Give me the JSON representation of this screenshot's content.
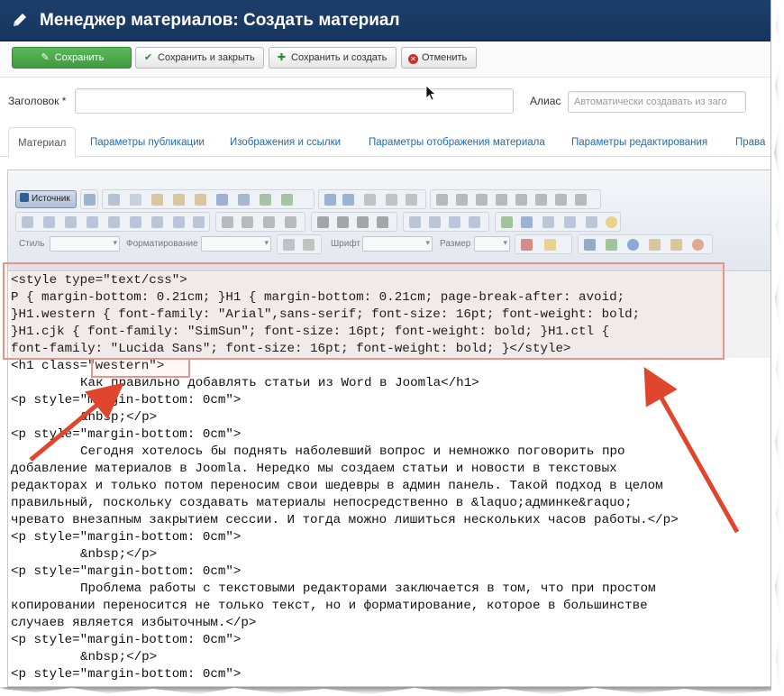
{
  "header": {
    "title": "Менеджер материалов: Создать материал"
  },
  "toolbar": {
    "save": "Сохранить",
    "save_close": "Сохранить и закрыть",
    "save_new": "Сохранить и создать",
    "cancel": "Отменить"
  },
  "form": {
    "title_label": "Заголовок *",
    "title_value": "",
    "alias_label": "Алиас",
    "alias_placeholder": "Автоматически создавать из заго"
  },
  "tabs": [
    {
      "label": "Материал",
      "active": true
    },
    {
      "label": "Параметры публикации"
    },
    {
      "label": "Изображения и ссылки"
    },
    {
      "label": "Параметры отображения материала"
    },
    {
      "label": "Параметры редактирования"
    },
    {
      "label": "Права"
    }
  ],
  "editor": {
    "source_button": "Источник",
    "combos": {
      "style_label": "Стиль",
      "format_label": "Форматирование",
      "font_label": "Шрифт",
      "size_label": "Размер"
    },
    "code_lines": [
      "<style type=\"text/css\">",
      "P { margin-bottom: 0.21cm; }H1 { margin-bottom: 0.21cm; page-break-after: avoid;",
      "}H1.western { font-family: \"Arial\",sans-serif; font-size: 16pt; font-weight: bold;",
      "}H1.cjk { font-family: \"SimSun\"; font-size: 16pt; font-weight: bold; }H1.ctl {",
      "font-family: \"Lucida Sans\"; font-size: 16pt; font-weight: bold; }</style>",
      "<h1 class=\"western\">",
      "Как правильно добавлять статьи из Word в Joomla</h1>",
      "<p style=\"margin-bottom: 0cm\">",
      "&nbsp;</p>",
      "<p style=\"margin-bottom: 0cm\">",
      "Сегодня хотелось бы поднять наболевший вопрос и немножко поговорить про",
      "добавление материалов в Joomla. Нередко мы создаем статьи и новости в текстовых",
      "редакторах и только потом переносим свои шедевры в админ панель. Такой подход в целом",
      "правильный, поскольку создавать материалы непосредственно в &laquo;админке&raquo;",
      "чревато внезапным закрытием сессии. И тогда можно лишиться нескольких часов работы.</p>",
      "<p style=\"margin-bottom: 0cm\">",
      "&nbsp;</p>",
      "<p style=\"margin-bottom: 0cm\">",
      "Проблема работы с текстовыми редакторами заключается в том, что при простом",
      "копировании переносится не только текст, но и форматирование, которое в большинстве",
      "случаев является избыточным.</p>",
      "<p style=\"margin-bottom: 0cm\">",
      "&nbsp;</p>",
      "<p style=\"margin-bottom: 0cm\">"
    ]
  },
  "colors": {
    "header_bg": "#17355c",
    "save_green": "#46a546",
    "link_blue": "#1f6bb5",
    "annotation_red": "#e0452d"
  }
}
